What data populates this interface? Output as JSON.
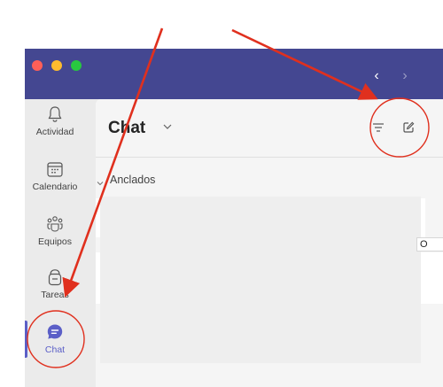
{
  "window": {
    "traffic_lights": [
      "close",
      "minimize",
      "zoom"
    ],
    "nav": {
      "back_icon": "chevron-left-icon",
      "forward_icon": "chevron-right-icon"
    }
  },
  "sidebar": {
    "items": [
      {
        "label": "Actividad",
        "icon": "bell-icon"
      },
      {
        "label": "Calendario",
        "icon": "calendar-icon"
      },
      {
        "label": "Equipos",
        "icon": "teams-icon"
      },
      {
        "label": "Tareas",
        "icon": "tasks-icon"
      },
      {
        "label": "Chat",
        "icon": "chat-icon",
        "active": true
      }
    ]
  },
  "header": {
    "title": "Chat",
    "filter_icon": "filter-icon",
    "compose_icon": "new-chat-icon"
  },
  "content": {
    "section_label": "Anclados",
    "cut_text": "O"
  },
  "colors": {
    "titlebar": "#444791",
    "accent": "#5b5fc7",
    "annotation": "#e0301e"
  }
}
